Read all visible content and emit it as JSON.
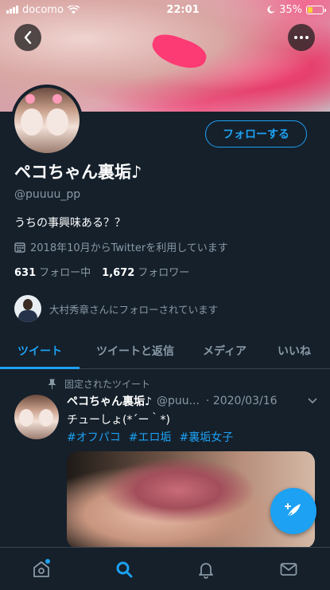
{
  "status_bar": {
    "carrier": "docomo",
    "time": "22:01",
    "battery": "35%",
    "battery_level": 0.35
  },
  "profile": {
    "follow_label": "フォローする",
    "display_name": "ペコちゃん裏垢♪",
    "handle": "@puuuu_pp",
    "bio": "うちの事興味ある？？",
    "joined": "2018年10月からTwitterを利用しています",
    "following_count": "631",
    "following_label": "フォロー中",
    "followers_count": "1,672",
    "followers_label": "フォロワー",
    "followed_by": "大村秀章さんにフォローされています"
  },
  "tabs": [
    {
      "label": "ツイート",
      "active": true
    },
    {
      "label": "ツイートと返信",
      "active": false
    },
    {
      "label": "メディア",
      "active": false
    },
    {
      "label": "いいね",
      "active": false
    }
  ],
  "tweet": {
    "pinned_label": "固定されたツイート",
    "name": "ペコちゃん裏垢♪",
    "handle": "@puu...",
    "date": "· 2020/03/16",
    "text": "チューしょ(*´ー｀*)",
    "hashtags": [
      "#オフパコ",
      "#エロ垢",
      "#裏垢女子"
    ]
  },
  "colors": {
    "accent": "#1da1f2",
    "background": "#15202b",
    "secondary_text": "#8899a6"
  },
  "icons": {
    "back": "back-arrow-icon",
    "more": "more-icon",
    "calendar": "calendar-icon",
    "pin": "pin-icon",
    "compose": "compose-icon",
    "home": "home-icon",
    "search": "search-icon",
    "notifications": "bell-icon",
    "messages": "mail-icon"
  }
}
